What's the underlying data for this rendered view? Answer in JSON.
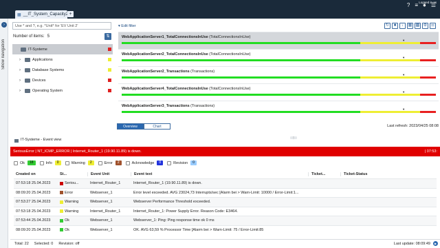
{
  "app": {
    "tab_title": "__IT_System_Capacity2",
    "tab_add": "+",
    "logged_in": "Logged in as",
    "colors": {
      "topbar": "#1a2a3a",
      "accent": "#2a68b0",
      "error": "#e00000",
      "ok": "#22dd22",
      "warning": "#eeee33"
    }
  },
  "rail": {
    "label": "Show navigation"
  },
  "left": {
    "filter_placeholder": "Use * and ?, e.g. *Unit* for 'EV Unit 2'",
    "items_label": "Number of items:",
    "items_count": "5",
    "tree": [
      {
        "label": "IT-Systeme",
        "status_color": "#e02020",
        "root": true
      },
      {
        "label": "Applications",
        "status_color": "#eeee33"
      },
      {
        "label": "Database Systems",
        "status_color": "#eeee33"
      },
      {
        "label": "Devices",
        "status_color": "#e02020"
      },
      {
        "label": "Operating System",
        "status_color": "#e02020"
      }
    ]
  },
  "right": {
    "edit_filter": "Edit filter",
    "toolbar_icons": [
      "refresh-icon",
      "save-icon",
      "export-icon",
      "table-icon",
      "bar-chart-icon",
      "settings-icon",
      "list-icon"
    ],
    "bars": [
      {
        "name": "WebApplicationServer1_TotalConnectionsInUse",
        "sub": "(TotalConnectionsInUse)",
        "green": 0.76,
        "yellow": 0.19,
        "red": 0.05
      },
      {
        "name": "WebApplicationServer2_TotalConnectionsInUse",
        "sub": "(TotalConnectionsInUse)",
        "green": 0.76,
        "yellow": 0.19,
        "red": 0.05
      },
      {
        "name": "WebApplicationServer2_Transactions",
        "sub": "(Transactions)",
        "green": 0.76,
        "yellow": 0.19,
        "red": 0.05
      },
      {
        "name": "WebApplicationServer4_TotalConnectionsInUse",
        "sub": "(TotalConnectionsInUse)",
        "green": 0.76,
        "yellow": 0.19,
        "red": 0.05
      },
      {
        "name": "WebApplicationServer3_Transactions",
        "sub": "(Transactions)",
        "green": 0.76,
        "yellow": 0.19,
        "red": 0.05
      }
    ],
    "tab_overview": "Overview",
    "tab_chart": "Chart",
    "last_refresh": "Last refresh: 2023/04/25 08:08"
  },
  "events": {
    "title": "IT-Systeme - Event view",
    "alert_text": "SeriousError | NT_ICMP_ERROR | Internet_Router_1 (19.90.11.89) is down.",
    "alert_right": "| 07:53:",
    "filters": [
      {
        "label": "Ok",
        "count": "18",
        "bg": "#33cc33",
        "fg": "#000"
      },
      {
        "label": "Info",
        "count": "0",
        "bg": "#eeee33",
        "fg": "#000"
      },
      {
        "label": "Warning",
        "count": "2",
        "bg": "#eeee33",
        "fg": "#000"
      },
      {
        "label": "Error",
        "count": "2",
        "bg": "#a0522d",
        "fg": "#fff"
      },
      {
        "label": "Acknowledge",
        "count": "0",
        "bg": "#2233dd",
        "fg": "#fff"
      },
      {
        "label": "Revision",
        "count": "0",
        "bg": "#99ccff",
        "fg": "#000"
      }
    ],
    "columns": [
      "Created on",
      "St...",
      "Event Unit",
      "Event text",
      "Ticket...",
      "Ticket-Status"
    ],
    "rows": [
      {
        "created": "07:53:18 25.04.2023",
        "status": "Seriou...",
        "color": "#cc0000",
        "unit": "Internet_Router_1",
        "text": "Internet_Router_1 (19.90.11.89) is down."
      },
      {
        "created": "08:09:20 25.04.2023",
        "status": "Error",
        "color": "#a0522d",
        "unit": "Webserver_1",
        "text": "Error level exceeded. AVG 23024,73 Interrupts/sec [Alarm bei > Warn-Limit: 10000 / Error-Limit:1..."
      },
      {
        "created": "07:53:27 25.04.2023",
        "status": "Warning",
        "color": "#eeee33",
        "unit": "Webserver_1",
        "text": "Webserver Performance Threshold exceeded."
      },
      {
        "created": "07:53:18 25.04.2023",
        "status": "Warning",
        "color": "#eeee33",
        "unit": "Internet_Router_1",
        "text": "Internet_Router_1: Power Supply Error. Reason Code: E3464."
      },
      {
        "created": "07:53:44 25.04.2023",
        "status": "Ok",
        "color": "#33cc33",
        "unit": "Webserver_1",
        "text": "Webserver_1: Ping: Ping response time ok 0 ms"
      },
      {
        "created": "08:09:20 25.04.2023",
        "status": "Ok",
        "color": "#33cc33",
        "unit": "Webserver_1",
        "text": "OK. AVG 63,59 % Processor Time [Alarm bei > Warn-Limit: 75 / Error-Limit:85"
      }
    ],
    "total": "Total: 22",
    "selected": "Selected: 0",
    "revision": "Revision: off",
    "last_update": "Last update: 08:09:49"
  }
}
